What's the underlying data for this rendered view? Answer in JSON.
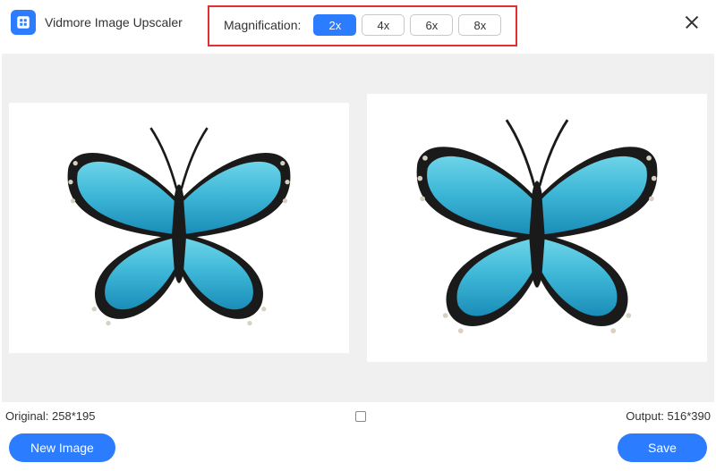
{
  "app": {
    "title": "Vidmore Image Upscaler"
  },
  "magnification": {
    "label": "Magnification:",
    "options": [
      "2x",
      "4x",
      "6x",
      "8x"
    ],
    "selected": "2x"
  },
  "info": {
    "original_label": "Original: 258*195",
    "output_label": "Output: 516*390"
  },
  "actions": {
    "new_image": "New Image",
    "save": "Save"
  },
  "colors": {
    "accent": "#2b7cff",
    "highlight_box": "#e03030"
  }
}
